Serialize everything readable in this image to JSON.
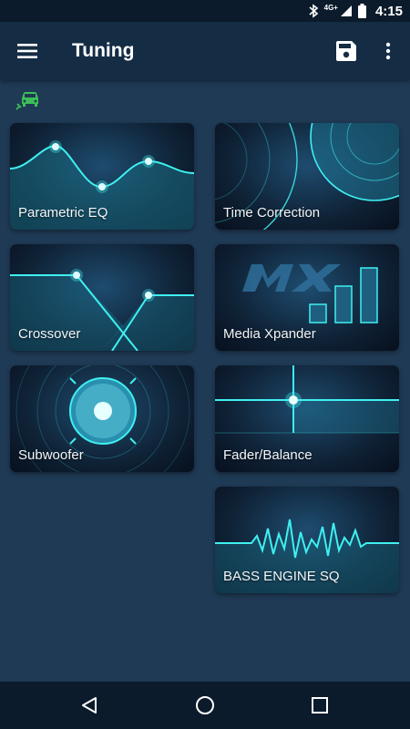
{
  "status": {
    "time": "4:15",
    "network": "4G+"
  },
  "app_bar": {
    "title": "Tuning"
  },
  "tiles": [
    {
      "label": "Parametric EQ"
    },
    {
      "label": "Time Correction"
    },
    {
      "label": "Crossover"
    },
    {
      "label": "Media Xpander"
    },
    {
      "label": "Subwoofer"
    },
    {
      "label": "Fader/Balance"
    },
    {
      "label": "BASS ENGINE SQ"
    }
  ],
  "icons": {
    "menu": "menu-icon",
    "save": "save-icon",
    "more": "more-vert-icon",
    "car": "car-connection-icon",
    "back": "back-icon",
    "home": "home-icon",
    "recents": "recents-icon"
  },
  "colors": {
    "accent": "#3ff0f0",
    "app_bar": "#142c44",
    "background": "#1f3a55",
    "car_icon": "#3cbf57"
  }
}
